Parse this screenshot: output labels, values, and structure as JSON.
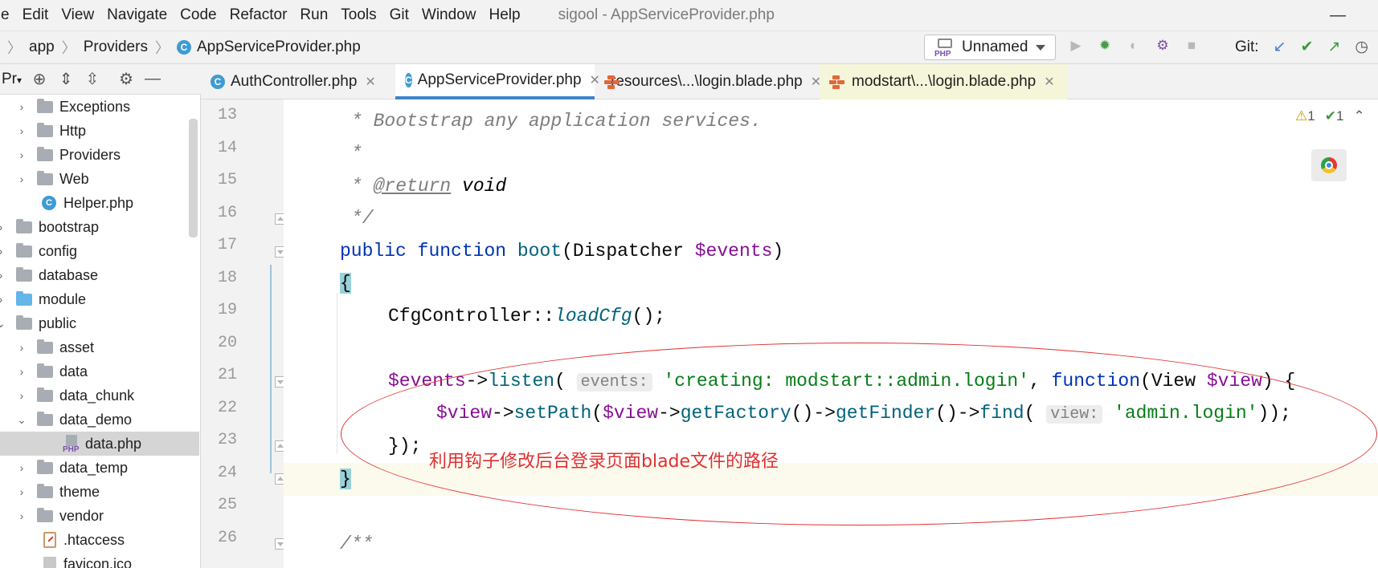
{
  "menu": {
    "items": [
      "e",
      "Edit",
      "View",
      "Navigate",
      "Code",
      "Refactor",
      "Run",
      "Tools",
      "Git",
      "Window",
      "Help"
    ],
    "window_title": "sigool - AppServiceProvider.php",
    "minimize_glyph": "—"
  },
  "navbar": {
    "breadcrumb": [
      "app",
      "Providers",
      "AppServiceProvider.php"
    ],
    "run_config": "Unnamed",
    "git_label": "Git:"
  },
  "project": {
    "header_label": "Pr",
    "tree": [
      {
        "label": "Exceptions",
        "type": "folder",
        "expanded": false
      },
      {
        "label": "Http",
        "type": "folder",
        "expanded": false
      },
      {
        "label": "Providers",
        "type": "folder",
        "expanded": false
      },
      {
        "label": "Web",
        "type": "folder",
        "expanded": false
      },
      {
        "label": "Helper.php",
        "type": "php-class"
      },
      {
        "label": "bootstrap",
        "type": "folder",
        "expanded": false
      },
      {
        "label": "config",
        "type": "folder",
        "expanded": false
      },
      {
        "label": "database",
        "type": "folder",
        "expanded": false
      },
      {
        "label": "module",
        "type": "folder-blue",
        "expanded": false
      },
      {
        "label": "public",
        "type": "folder",
        "expanded": true
      },
      {
        "label": "asset",
        "type": "folder",
        "expanded": false
      },
      {
        "label": "data",
        "type": "folder",
        "expanded": false
      },
      {
        "label": "data_chunk",
        "type": "folder",
        "expanded": false
      },
      {
        "label": "data_demo",
        "type": "folder",
        "expanded": true
      },
      {
        "label": "data.php",
        "type": "php-file",
        "selected": true
      },
      {
        "label": "data_temp",
        "type": "folder",
        "expanded": false
      },
      {
        "label": "theme",
        "type": "folder",
        "expanded": false
      },
      {
        "label": "vendor",
        "type": "folder",
        "expanded": false
      },
      {
        "label": ".htaccess",
        "type": "htaccess"
      },
      {
        "label": "favicon.ico",
        "type": "file"
      }
    ]
  },
  "tabs": [
    {
      "label": "AuthController.php",
      "icon": "php-class-icon",
      "active": false
    },
    {
      "label": "AppServiceProvider.php",
      "icon": "php-class-icon",
      "active": true
    },
    {
      "label": "resources\\...\\login.blade.php",
      "icon": "blade-icon",
      "active": false
    },
    {
      "label": "modstart\\...\\login.blade.php",
      "icon": "blade-icon",
      "active": false
    }
  ],
  "editor": {
    "line_numbers": [
      "13",
      "14",
      "15",
      "16",
      "17",
      "18",
      "19",
      "20",
      "21",
      "22",
      "23",
      "24",
      "25",
      "26"
    ],
    "code": {
      "l13": "* Bootstrap any application services.",
      "l14": "*",
      "l15_star": "* ",
      "l15_tag": "@return",
      "l15_type": "void",
      "l16": "*/",
      "l17_kw1": "public",
      "l17_kw2": "function",
      "l17_fn": "boot",
      "l17_param_type": "Dispatcher",
      "l17_param_var": "$events",
      "l18": "{",
      "l19_class": "CfgController",
      "l19_method": "loadCfg",
      "l21_var": "$events",
      "l21_method": "listen",
      "l21_hint": "events:",
      "l21_str": "'creating: modstart::admin.login'",
      "l21_kw": "function",
      "l21_type": "View",
      "l21_param": "$view",
      "l22_var": "$view",
      "l22_m1": "setPath",
      "l22_var2": "$view",
      "l22_m2": "getFactory",
      "l22_m3": "getFinder",
      "l22_m4": "find",
      "l22_hint": "view:",
      "l22_str": "'admin.login'",
      "l23": "});",
      "l24": "}",
      "l26": "/**"
    },
    "inspections": {
      "warnings": "1",
      "ok": "1"
    }
  },
  "annotation": {
    "text": "利用钩子修改后台登录页面blade文件的路径",
    "color": "#e0302e"
  }
}
